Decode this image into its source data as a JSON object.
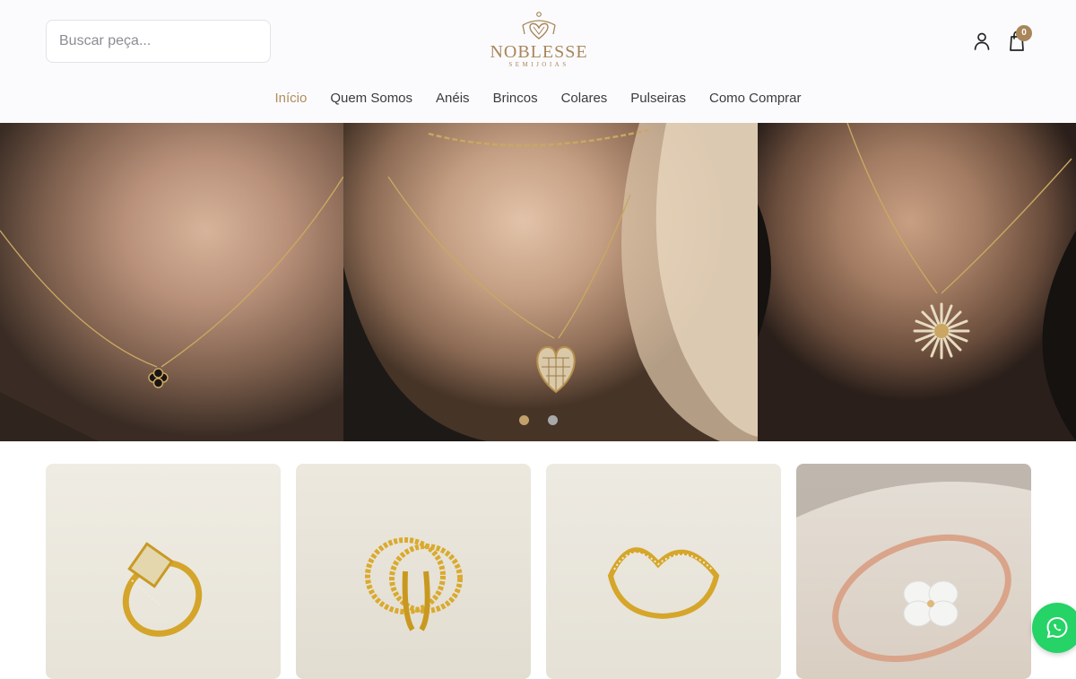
{
  "header": {
    "search": {
      "placeholder": "Buscar peça..."
    },
    "logo": {
      "brand": "NOBLESSE",
      "sub": "SEMIJOIAS"
    },
    "cart": {
      "count": "0"
    }
  },
  "nav": {
    "items": [
      {
        "label": "Início",
        "active": true
      },
      {
        "label": "Quem Somos"
      },
      {
        "label": "Anéis"
      },
      {
        "label": "Brincos"
      },
      {
        "label": "Colares"
      },
      {
        "label": "Pulseiras"
      },
      {
        "label": "Como Comprar"
      }
    ]
  },
  "hero": {
    "slides": 2,
    "active_slide": 1,
    "images": [
      "necklace-clover-pendant",
      "necklace-heart-pendant",
      "necklace-snowflake-pendant"
    ]
  },
  "products": [
    {
      "image": "gold-zircon-ring"
    },
    {
      "image": "gold-beaded-double-ring"
    },
    {
      "image": "gold-chevron-ring"
    },
    {
      "image": "rose-gold-flower-bracelet"
    }
  ],
  "icons": {
    "user": "user-icon",
    "bag": "shopping-bag-icon",
    "whatsapp": "whatsapp-icon"
  },
  "colors": {
    "accent": "#b08d5e",
    "text": "#3b3b40",
    "whatsapp": "#25d366"
  }
}
